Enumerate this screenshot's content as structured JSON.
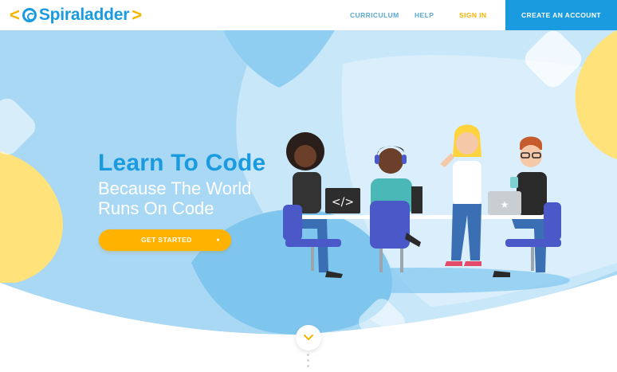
{
  "header": {
    "logo": {
      "left_bracket": "<",
      "name": "Spiraladder",
      "right_bracket": ">"
    },
    "nav": [
      {
        "label": "CURRICULUM"
      },
      {
        "label": "HELP"
      },
      {
        "label": "SIGN IN"
      }
    ],
    "cta_label": "CREATE AN ACCOUNT"
  },
  "hero": {
    "headline": "Learn To Code",
    "subline": "Because The World Runs On Code",
    "button_label": "GET STARTED",
    "button_glyph": "●"
  },
  "icons": {
    "logo": "spiral-logo-icon",
    "scroll": "chevron-down-icon",
    "laptop_code": "code-brackets-icon",
    "laptop_star": "star-icon"
  },
  "colors": {
    "brand_blue": "#1a9be0",
    "brand_yellow": "#ffb300",
    "nav_text": "#5aa8cf",
    "hero_background": "#a8d8f3"
  }
}
